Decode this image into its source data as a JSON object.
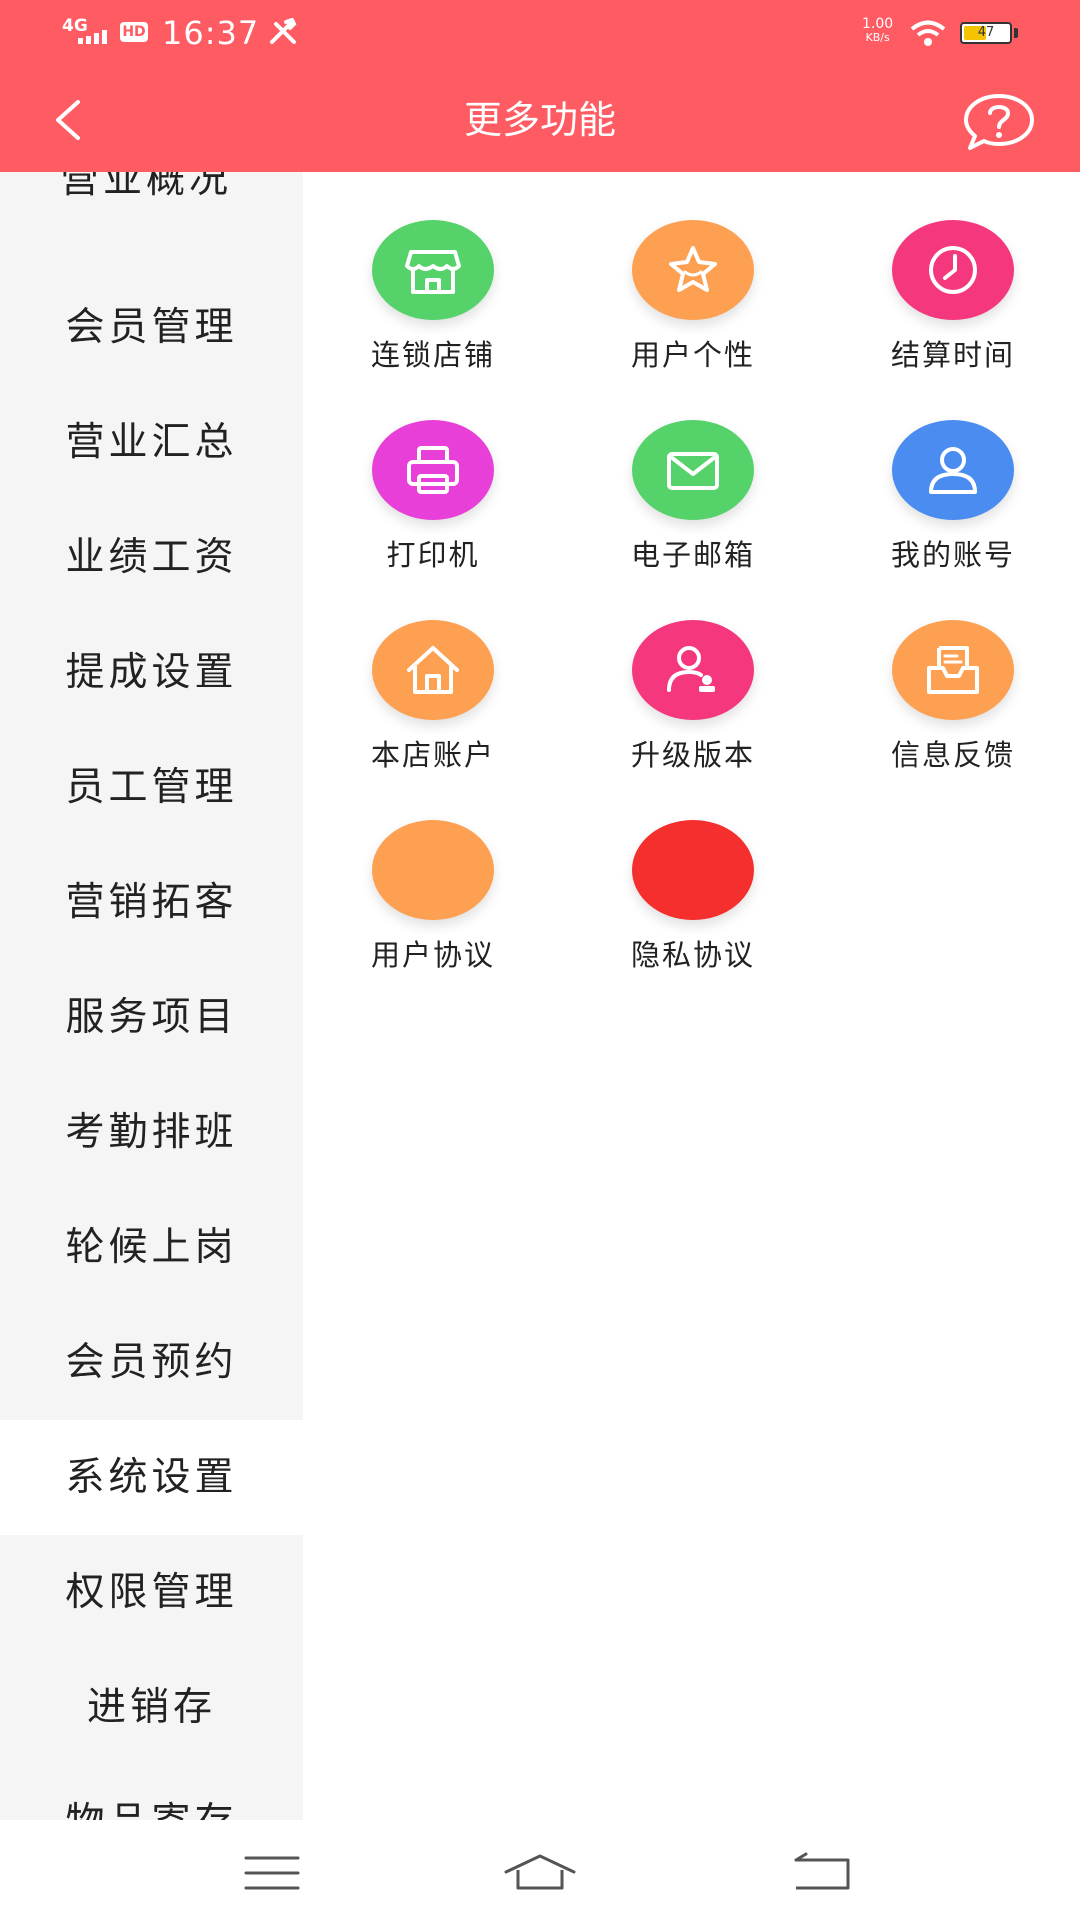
{
  "status_bar": {
    "network": "4G",
    "hd": "HD",
    "time": "16:37",
    "speed_value": "1.00",
    "speed_unit": "KB/s",
    "battery": "47"
  },
  "header": {
    "title": "更多功能"
  },
  "sidebar": {
    "partial_item": "营业概况",
    "items": [
      "会员管理",
      "营业汇总",
      "业绩工资",
      "提成设置",
      "员工管理",
      "营销拓客",
      "服务项目",
      "考勤排班",
      "轮候上岗",
      "会员预约",
      "系统设置",
      "权限管理",
      "进销存",
      "物品寄存"
    ],
    "active_index": 10
  },
  "grid": [
    {
      "label": "连锁店铺",
      "color": "#56d26b",
      "icon": "store-icon"
    },
    {
      "label": "用户个性",
      "color": "#fda052",
      "icon": "star-icon"
    },
    {
      "label": "结算时间",
      "color": "#f5377d",
      "icon": "clock-icon"
    },
    {
      "label": "打印机",
      "color": "#e83fd8",
      "icon": "printer-icon"
    },
    {
      "label": "电子邮箱",
      "color": "#56d26b",
      "icon": "mail-icon"
    },
    {
      "label": "我的账号",
      "color": "#4a8cf0",
      "icon": "user-icon"
    },
    {
      "label": "本店账户",
      "color": "#fda052",
      "icon": "home-icon"
    },
    {
      "label": "升级版本",
      "color": "#f5377d",
      "icon": "user-badge-icon"
    },
    {
      "label": "信息反馈",
      "color": "#fda052",
      "icon": "inbox-icon"
    },
    {
      "label": "用户协议",
      "color": "#fda052",
      "icon": ""
    },
    {
      "label": "隐私协议",
      "color": "#f52e2e",
      "icon": ""
    }
  ]
}
